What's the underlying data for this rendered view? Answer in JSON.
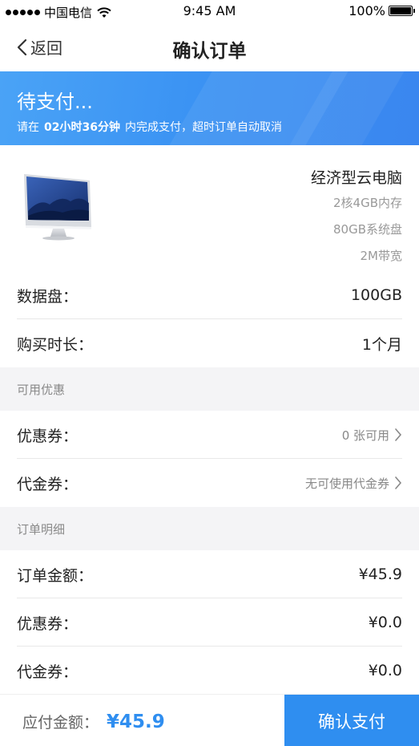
{
  "status_bar": {
    "carrier": "中国电信",
    "time": "9:45 AM",
    "battery": "100%",
    "battery_level": 1.0
  },
  "nav": {
    "back_label": "返回",
    "title": "确认订单"
  },
  "banner": {
    "title": "待支付...",
    "sub_prefix": "请在",
    "countdown": "02小时36分钟",
    "sub_suffix": "内完成支付，超时订单自动取消"
  },
  "product": {
    "name": "经济型云电脑",
    "specs": [
      "2核4GB内存",
      "80GB系统盘",
      "2M带宽"
    ]
  },
  "config": {
    "data_disk": {
      "label": "数据盘：",
      "value": "100GB"
    },
    "duration": {
      "label": "购买时长：",
      "value": "1个月"
    }
  },
  "discounts": {
    "header": "可用优惠",
    "coupon": {
      "label": "优惠券：",
      "value": "0 张可用"
    },
    "voucher": {
      "label": "代金券：",
      "value": "无可使用代金券"
    }
  },
  "details": {
    "header": "订单明细",
    "order_amount": {
      "label": "订单金额：",
      "value": "¥45.9"
    },
    "coupon": {
      "label": "优惠券：",
      "value": "¥0.0"
    },
    "voucher": {
      "label": "代金券：",
      "value": "¥0.0"
    }
  },
  "bottom": {
    "pay_label": "应付金额：",
    "pay_amount": "¥45.9",
    "confirm_label": "确认支付"
  },
  "colors": {
    "accent": "#2f8ef0",
    "banner": "#3b93f3",
    "section_bg": "#f4f4f6"
  }
}
